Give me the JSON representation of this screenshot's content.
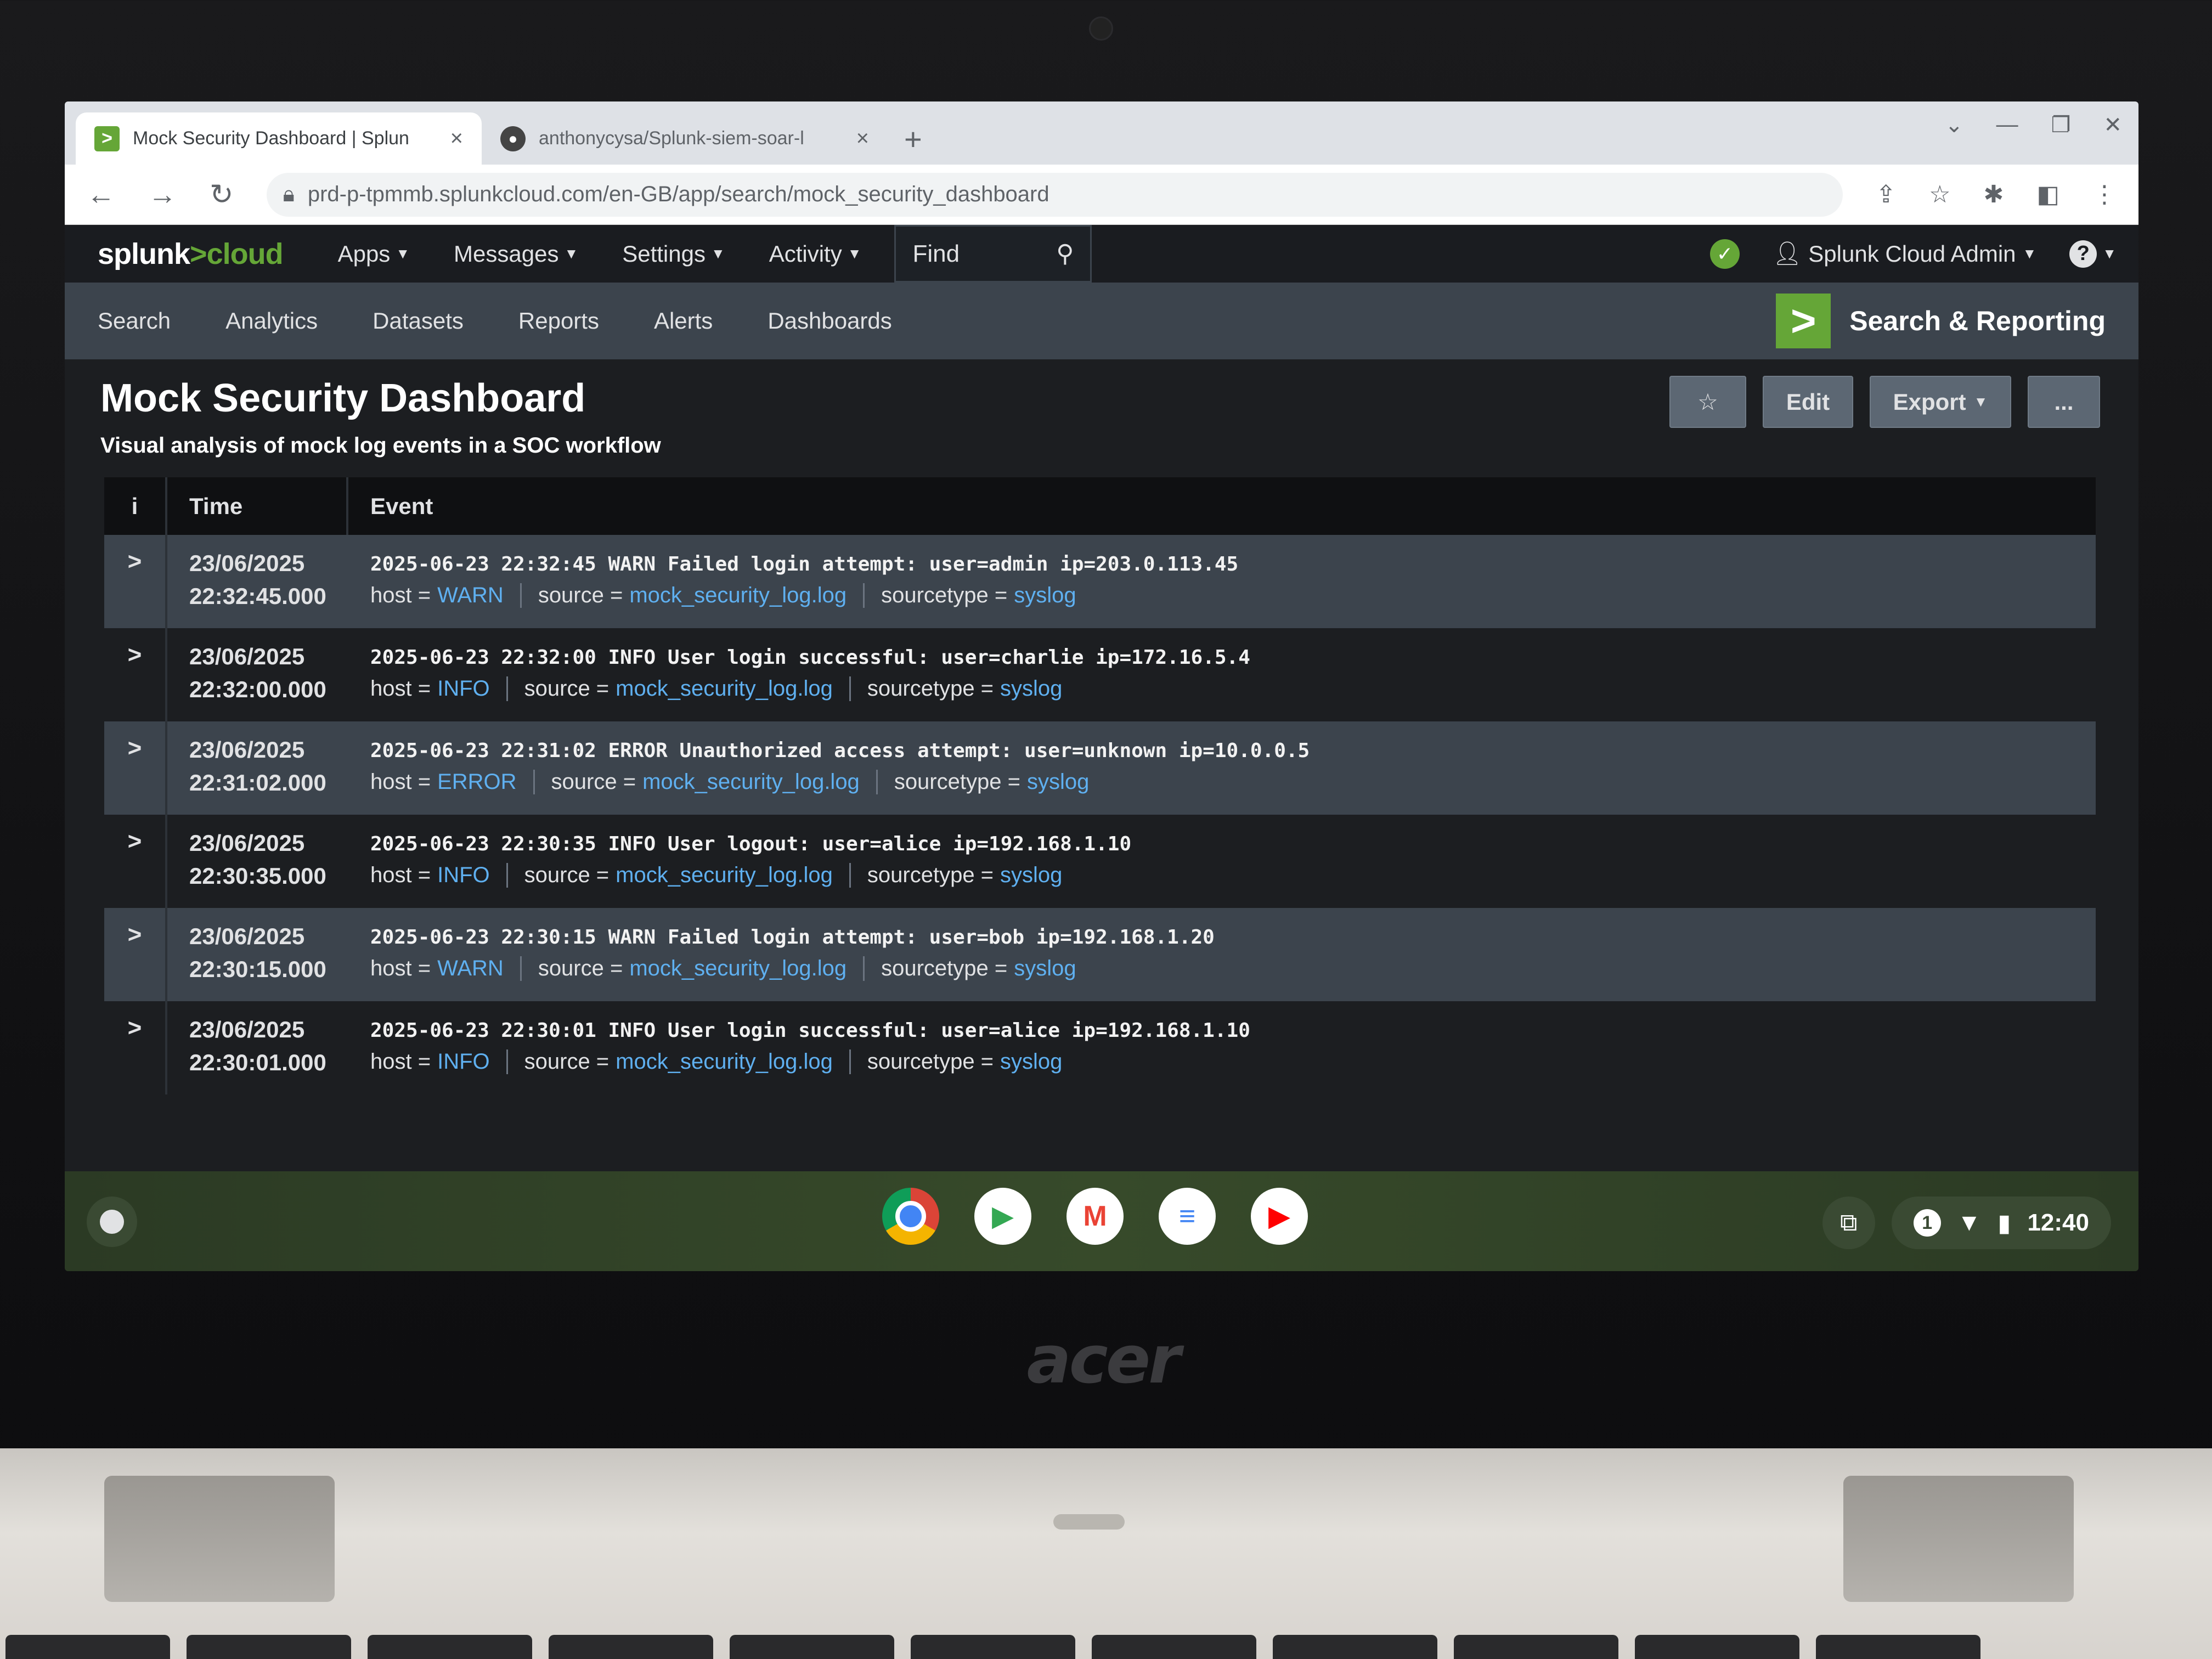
{
  "browser": {
    "tabs": [
      {
        "title": "Mock Security Dashboard | Splun",
        "active": true,
        "favicon": "splunk-favicon"
      },
      {
        "title": "anthonycysa/Splunk-siem-soar-l",
        "active": false,
        "favicon": "github-favicon"
      }
    ],
    "url": "prd-p-tpmmb.splunkcloud.com/en-GB/app/search/mock_security_dashboard"
  },
  "topbar": {
    "logo_text": "splunk",
    "logo_gt": ">",
    "logo_cloud": "cloud",
    "menu": [
      "Apps",
      "Messages",
      "Settings",
      "Activity"
    ],
    "find_label": "Find",
    "user": "Splunk Cloud Admin",
    "help": "?"
  },
  "appbar": {
    "nav": [
      "Search",
      "Analytics",
      "Datasets",
      "Reports",
      "Alerts",
      "Dashboards"
    ],
    "app_name": "Search & Reporting"
  },
  "dashboard": {
    "title": "Mock Security Dashboard",
    "description": "Visual analysis of mock log events in a SOC workflow",
    "actions": {
      "star": "☆",
      "edit": "Edit",
      "export": "Export",
      "more": "..."
    }
  },
  "events": {
    "headers": {
      "info": "i",
      "time": "Time",
      "event": "Event"
    },
    "field_labels": {
      "host": "host =",
      "source": "source =",
      "sourcetype": "sourcetype ="
    },
    "rows": [
      {
        "date": "23/06/2025",
        "time": "22:32:45.000",
        "raw": "2025-06-23 22:32:45 WARN Failed login attempt: user=admin ip=203.0.113.45",
        "host": "WARN",
        "source": "mock_security_log.log",
        "sourcetype": "syslog"
      },
      {
        "date": "23/06/2025",
        "time": "22:32:00.000",
        "raw": "2025-06-23 22:32:00 INFO User login successful: user=charlie ip=172.16.5.4",
        "host": "INFO",
        "source": "mock_security_log.log",
        "sourcetype": "syslog"
      },
      {
        "date": "23/06/2025",
        "time": "22:31:02.000",
        "raw": "2025-06-23 22:31:02 ERROR Unauthorized access attempt: user=unknown ip=10.0.0.5",
        "host": "ERROR",
        "source": "mock_security_log.log",
        "sourcetype": "syslog"
      },
      {
        "date": "23/06/2025",
        "time": "22:30:35.000",
        "raw": "2025-06-23 22:30:35 INFO User logout: user=alice ip=192.168.1.10",
        "host": "INFO",
        "source": "mock_security_log.log",
        "sourcetype": "syslog"
      },
      {
        "date": "23/06/2025",
        "time": "22:30:15.000",
        "raw": "2025-06-23 22:30:15 WARN Failed login attempt: user=bob ip=192.168.1.20",
        "host": "WARN",
        "source": "mock_security_log.log",
        "sourcetype": "syslog"
      },
      {
        "date": "23/06/2025",
        "time": "22:30:01.000",
        "raw": "2025-06-23 22:30:01 INFO User login successful: user=alice ip=192.168.1.10",
        "host": "INFO",
        "source": "mock_security_log.log",
        "sourcetype": "syslog"
      }
    ]
  },
  "shelf": {
    "apps": [
      {
        "name": "chrome",
        "glyph": ""
      },
      {
        "name": "play-store",
        "glyph": "▶"
      },
      {
        "name": "gmail",
        "glyph": "M"
      },
      {
        "name": "docs",
        "glyph": "≡"
      },
      {
        "name": "youtube",
        "glyph": "▶"
      }
    ],
    "notification_count": "1",
    "clock": "12:40"
  },
  "device": {
    "brand": "acer"
  },
  "colors": {
    "splunk_green": "#65a637",
    "field_link": "#5fb0f0",
    "appbar": "#3c444d"
  }
}
